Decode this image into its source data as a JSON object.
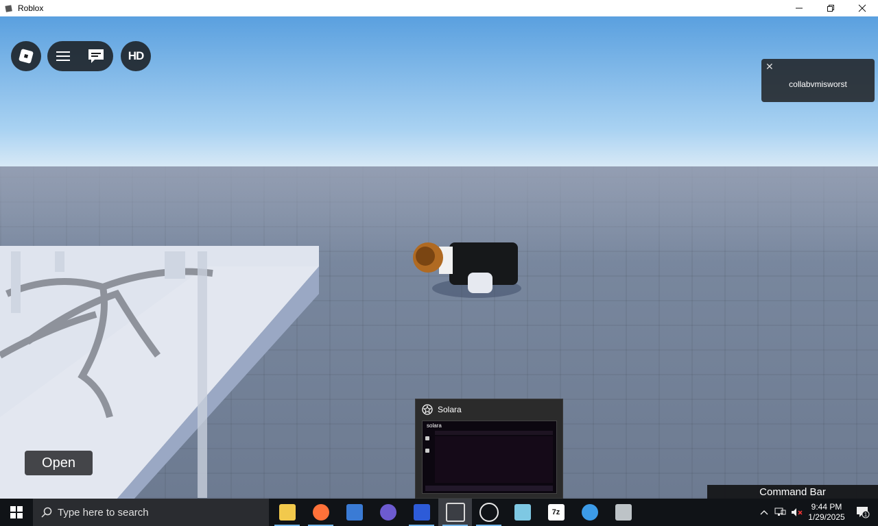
{
  "window": {
    "title": "Roblox",
    "minimize_icon": "minimize-icon",
    "restore_icon": "restore-icon",
    "close_icon": "close-icon"
  },
  "hud": {
    "roblox_icon": "roblox-logo-icon",
    "menu_icon": "hamburger-menu-icon",
    "chat_icon": "chat-icon",
    "hd_label": "HD"
  },
  "notification": {
    "close_glyph": "✕",
    "message": "collabvmisworst"
  },
  "open_button": {
    "label": "Open"
  },
  "command_bar": {
    "label": "Command Bar"
  },
  "taskbar_preview": {
    "title": "Solara",
    "preview_label": "solara"
  },
  "taskbar": {
    "search_placeholder": "Type here to search",
    "apps": [
      {
        "name": "file-explorer",
        "icon": "folder-icon",
        "color": "#f2c94c"
      },
      {
        "name": "firefox",
        "icon": "firefox-icon",
        "color": "#ff7139"
      },
      {
        "name": "app-3",
        "icon": "app-icon",
        "color": "#3a7bd5"
      },
      {
        "name": "app-4",
        "icon": "app-icon",
        "color": "#6d5bd0"
      },
      {
        "name": "app-5",
        "icon": "app-icon",
        "color": "#2d5bd8"
      },
      {
        "name": "roblox",
        "icon": "roblox-icon",
        "color": "#d9d9d9"
      },
      {
        "name": "solara",
        "icon": "solara-icon",
        "color": "#e8e8e8"
      },
      {
        "name": "app-8",
        "icon": "app-icon",
        "color": "#7ec8e3"
      },
      {
        "name": "7zip",
        "icon": "7z-icon",
        "color": "#ffffff",
        "text": "7z"
      },
      {
        "name": "internet-explorer",
        "icon": "ie-icon",
        "color": "#3c9be8"
      },
      {
        "name": "app-11",
        "icon": "app-icon",
        "color": "#bdc3c7"
      }
    ],
    "clock_time": "9:44 PM",
    "clock_date": "1/29/2025",
    "notification_count": "1"
  }
}
